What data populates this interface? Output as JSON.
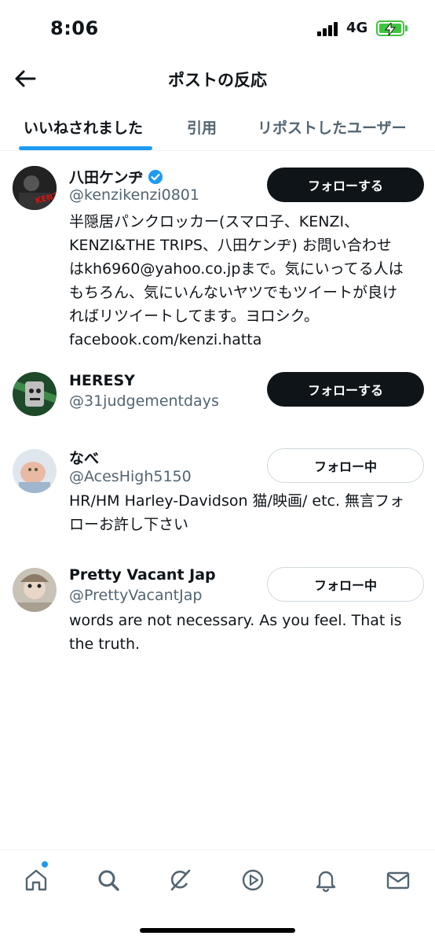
{
  "status_bar": {
    "time": "8:06",
    "network": "4G"
  },
  "header": {
    "title": "ポストの反応"
  },
  "tabs": [
    {
      "label": "いいねされました",
      "active": true
    },
    {
      "label": "引用",
      "active": false
    },
    {
      "label": "リポストしたユーザー",
      "active": false
    }
  ],
  "users": [
    {
      "name": "八田ケンヂ",
      "verified": true,
      "handle": "@kenzikenzi0801",
      "bio": "半隠居パンクロッカー(スマロ子、KENZI、\nKENZI&THE TRIPS、八田ケンヂ) お問い合わせ\nはkh6960@yahoo.co.jpまで。気にいってる人は\nもちろん、気にいんないヤツでもツイートが良け\nればリツイートしてます。ヨロシク。\nfacebook.com/kenzi.hatta",
      "follow_label": "フォローする",
      "avatar_text": "KENZI"
    },
    {
      "name": "HERESY",
      "verified": false,
      "handle": "@31judgementdays",
      "bio": "",
      "follow_label": "フォローする"
    },
    {
      "name": "なべ",
      "verified": false,
      "handle": "@AcesHigh5150",
      "bio": "HR/HM Harley-Davidson 猫/映画/ etc. 無言フォ\nローお許し下さい",
      "follow_label": "フォロー中"
    },
    {
      "name": "Pretty Vacant Jap",
      "verified": false,
      "handle": "@PrettyVacantJap",
      "bio": "words are not necessary. As you feel. That is\nthe truth.",
      "follow_label": "フォロー中"
    }
  ],
  "bottom_nav": [
    {
      "icon": "home-icon",
      "has_notification_dot": true
    },
    {
      "icon": "search-icon"
    },
    {
      "icon": "grok-icon"
    },
    {
      "icon": "video-play-icon"
    },
    {
      "icon": "bell-icon"
    },
    {
      "icon": "mail-icon"
    }
  ],
  "colors": {
    "accent": "#1d9bf0",
    "primary_text": "#0f1419",
    "secondary_text": "#536471",
    "battery": "#3fc53f"
  }
}
